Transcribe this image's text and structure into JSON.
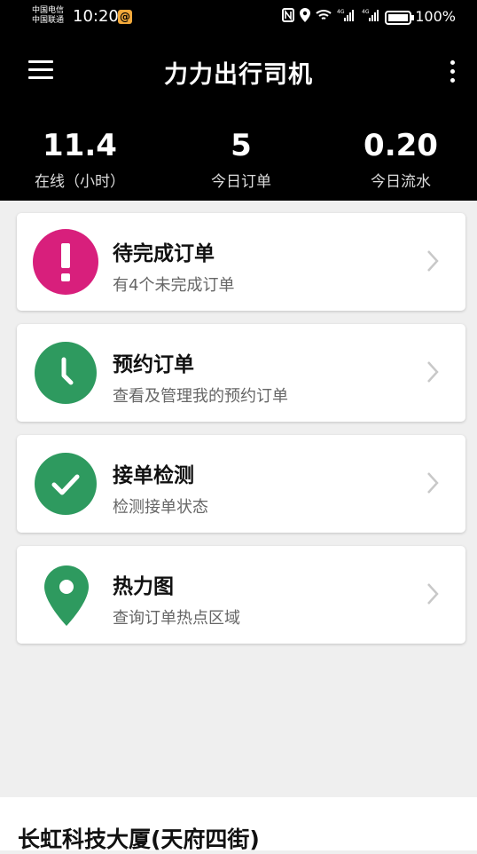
{
  "status_bar": {
    "carrier1": "中国电信",
    "carrier2": "中国联通",
    "time": "10:20",
    "battery": "100%"
  },
  "app_bar": {
    "title": "力力出行司机",
    "menu_icon": "hamburger-menu-icon",
    "more_icon": "more-vertical-icon"
  },
  "stats": [
    {
      "value": "11.4",
      "label": "在线（小时）"
    },
    {
      "value": "5",
      "label": "今日订单"
    },
    {
      "value": "0.20",
      "label": "今日流水"
    }
  ],
  "cards": [
    {
      "title": "待完成订单",
      "subtitle": "有4个未完成订单",
      "icon": "exclamation-icon",
      "color": "#d81f7c"
    },
    {
      "title": "预约订单",
      "subtitle": "查看及管理我的预约订单",
      "icon": "clock-icon",
      "color": "#2e9a5f"
    },
    {
      "title": "接单检测",
      "subtitle": "检测接单状态",
      "icon": "checkmark-icon",
      "color": "#2e9a5f"
    },
    {
      "title": "热力图",
      "subtitle": "查询订单热点区域",
      "icon": "location-pin-icon",
      "color": "#2e9a5f"
    }
  ],
  "footer": {
    "address": "长虹科技大厦(天府四街)"
  }
}
